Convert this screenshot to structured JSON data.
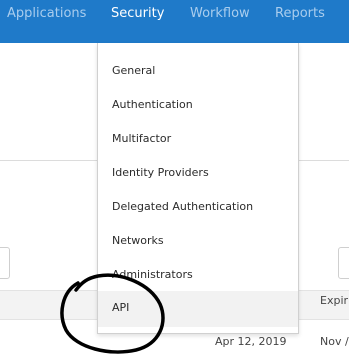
{
  "nav": {
    "items": [
      {
        "label": "Applications"
      },
      {
        "label": "Security"
      },
      {
        "label": "Workflow"
      },
      {
        "label": "Reports"
      }
    ]
  },
  "dropdown": {
    "items": [
      {
        "label": "General"
      },
      {
        "label": "Authentication"
      },
      {
        "label": "Multifactor"
      },
      {
        "label": "Identity Providers"
      },
      {
        "label": "Delegated Authentication"
      },
      {
        "label": "Networks"
      },
      {
        "label": "Administrators"
      },
      {
        "label": "API"
      }
    ]
  },
  "table": {
    "header_partial": "Expir",
    "row_date_partial": "Apr 12, 2019",
    "row_expiry_partial": "Nov /"
  },
  "colors": {
    "nav_bg": "#1f7ac9",
    "nav_inactive_text": "#a9cdee",
    "nav_active_text": "#ffffff",
    "annotation_ink": "#000000"
  }
}
